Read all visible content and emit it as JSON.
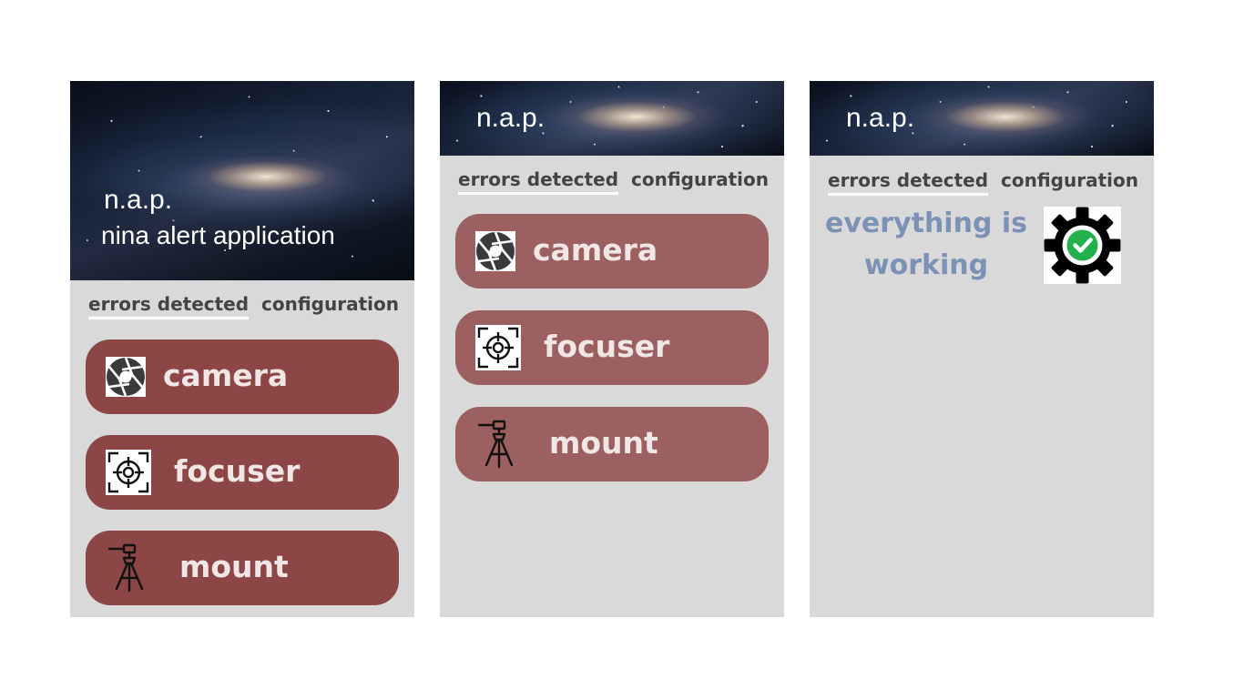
{
  "app": {
    "name": "n.a.p.",
    "subtitle": "nina alert application"
  },
  "tabs": {
    "errors": "errors detected",
    "config": "configuration"
  },
  "devices": [
    {
      "label": "camera",
      "icon": "camera-aperture-icon"
    },
    {
      "label": "focuser",
      "icon": "focuser-crosshair-icon"
    },
    {
      "label": "mount",
      "icon": "mount-tripod-icon"
    }
  ],
  "status": {
    "ok_message": "everything is working",
    "ok_icon": "gear-check-icon"
  },
  "colors": {
    "error_card_dark": "#8c4646",
    "error_card_light": "#9c6060",
    "panel_bg": "#d9d9d9",
    "ok_text": "#7b92b6",
    "ok_check": "#22b14c"
  }
}
